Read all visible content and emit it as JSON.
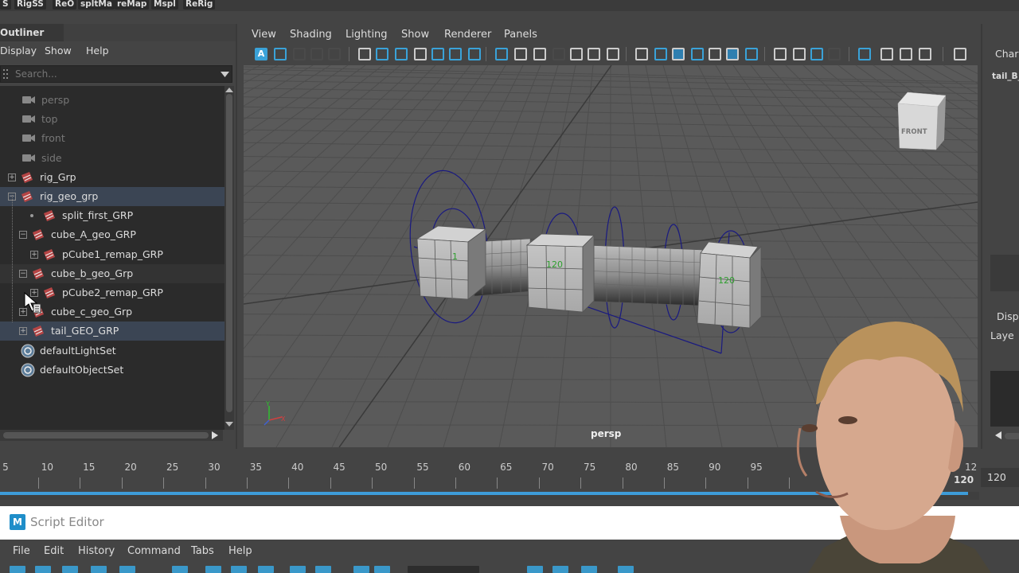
{
  "shelf": {
    "buttons": [
      "S",
      "RigSS",
      "ReO",
      "spltMa",
      "reMap",
      "Mspl",
      "ReRig"
    ]
  },
  "outliner": {
    "tab_label": "Outliner",
    "menu": [
      "Display",
      "Show",
      "Help"
    ],
    "search_placeholder": "Search...",
    "items": [
      {
        "label": "persp",
        "kind": "camera",
        "dim": true
      },
      {
        "label": "top",
        "kind": "camera",
        "dim": true
      },
      {
        "label": "front",
        "kind": "camera",
        "dim": true
      },
      {
        "label": "side",
        "kind": "camera",
        "dim": true
      },
      {
        "label": "rig_Grp",
        "kind": "group",
        "expander": "+"
      },
      {
        "label": "rig_geo_grp",
        "kind": "group",
        "expander": "−",
        "selected": true
      },
      {
        "label": "split_first_GRP",
        "kind": "group",
        "indent": 1,
        "dot": true
      },
      {
        "label": "cube_A_geo_GRP",
        "kind": "group",
        "indent": 1,
        "expander": "−"
      },
      {
        "label": "pCube1_remap_GRP",
        "kind": "group",
        "indent": 2,
        "expander": "+"
      },
      {
        "label": "cube_b_geo_Grp",
        "kind": "group",
        "indent": 1,
        "expander": "−",
        "hover": true
      },
      {
        "label": "pCube2_remap_GRP",
        "kind": "group",
        "indent": 2,
        "expander": "+"
      },
      {
        "label": "cube_c_geo_Grp",
        "kind": "group",
        "indent": 1,
        "expander": "+"
      },
      {
        "label": "tail_GEO_GRP",
        "kind": "group",
        "indent": 1,
        "expander": "+",
        "selected": true
      },
      {
        "label": "defaultLightSet",
        "kind": "set"
      },
      {
        "label": "defaultObjectSet",
        "kind": "set"
      }
    ]
  },
  "viewport": {
    "menu": [
      "View",
      "Shading",
      "Lighting",
      "Show",
      "Renderer",
      "Panels"
    ],
    "camera_label": "persp",
    "view_cube_label": "FRONT",
    "joint_labels": [
      "1",
      "120",
      "120"
    ],
    "axis_y": "Y",
    "axis_x": "X"
  },
  "right_panel": {
    "tab_label": "Char",
    "item_label": "tail_B_",
    "disp_label": "Disp",
    "layer_label": "Laye"
  },
  "timeline": {
    "ticks": [
      "5",
      "10",
      "15",
      "20",
      "25",
      "30",
      "35",
      "40",
      "45",
      "50",
      "55",
      "60",
      "65",
      "70",
      "75",
      "80",
      "85",
      "90",
      "95"
    ],
    "end_label_top": "12",
    "current_frame": "120",
    "end_field": "120"
  },
  "script_editor": {
    "title": "Script Editor",
    "menu": [
      "File",
      "Edit",
      "History",
      "Command",
      "Tabs",
      "Help"
    ]
  },
  "colors": {
    "accent_blue": "#3d9bd8",
    "selection": "#3b4554",
    "rig_curve": "#1a1a80"
  }
}
